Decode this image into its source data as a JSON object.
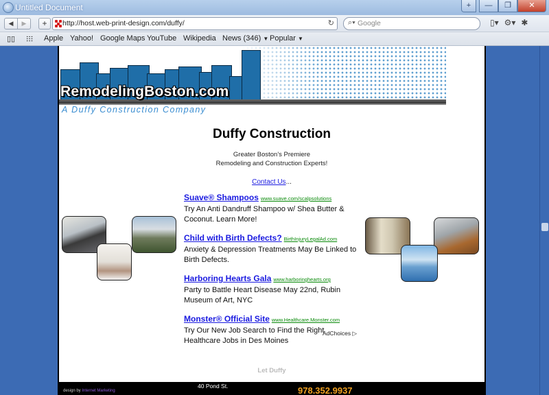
{
  "window": {
    "title": "Untitled Document",
    "controls": [
      "+",
      "—",
      "❐",
      "✕"
    ]
  },
  "toolbar": {
    "url": "http://host.web-print-design.com/duffy/",
    "search_placeholder": "Google",
    "back_glyph": "◀",
    "forward_glyph": "▶",
    "add_glyph": "+",
    "reload_glyph": "↻",
    "page_menu_glyph": "▯▾",
    "settings_glyph": "⚙▾",
    "bug_glyph": "✱"
  },
  "bookmarks": {
    "book_glyph": "📖",
    "items": [
      "Apple",
      "Yahoo!",
      "Google Maps",
      "YouTube",
      "Wikipedia",
      "News (346)",
      "Popular"
    ],
    "dropdown_glyph": "▼"
  },
  "site": {
    "brand": "RemodelingBoston.com",
    "tagline": "A Duffy Construction Company",
    "heading": "Duffy Construction",
    "subheading_line1": "Greater Boston's Premiere",
    "subheading_line2": "Remodeling and Construction Experts!",
    "contact_link": "Contact Us",
    "contact_suffix": "...",
    "ads": [
      {
        "title": "Suave® Shampoos",
        "url": "www.suave.com/scalpsolutions",
        "desc": "Try An Anti Dandruff Shampoo w/ Shea Butter & Coconut. Learn More!"
      },
      {
        "title": "Child with Birth Defects?",
        "url": "BirthInjuryLegalAd.com",
        "desc": "Anxiety & Depression Treatments May Be Linked to Birth Defects."
      },
      {
        "title": "Harboring Hearts Gala",
        "url": "www.harboringhearts.org",
        "desc": "Party to Battle Heart Disease May 22nd, Rubin Museum of Art, NYC"
      },
      {
        "title": "Monster® Official Site",
        "url": "www.Healthcare.Monster.com",
        "desc": "Try Our New Job Search to Find the Right Healthcare Jobs in Des Moines"
      }
    ],
    "adchoices": "AdChoices ▷",
    "let_duffy": "Let Duffy",
    "footer": {
      "design_prefix": "design by",
      "design_link": "Internet Marketing",
      "address": "40 Pond St.",
      "phone": "978.352.9937"
    }
  }
}
